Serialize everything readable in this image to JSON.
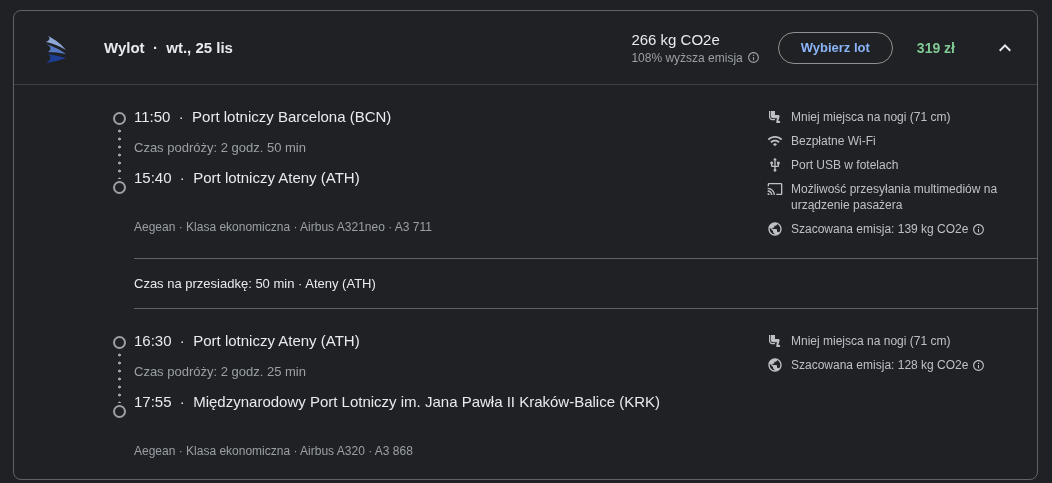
{
  "flight": {
    "title": "Wylot  ·  wt., 25 lis",
    "emissions": "266 kg CO2e",
    "emissions_note": "108% wyższa emisja",
    "select_button": "Wybierz lot",
    "price": "319 zł",
    "expanded": true
  },
  "legs": [
    {
      "kind": "flight",
      "departure": "11:50  ·  Port lotniczy Barcelona (BCN)",
      "duration": "Czas podróży: 2 godz. 50 min",
      "arrival": "15:40  ·  Port lotniczy Ateny (ATH)",
      "details": "Aegean · Klasa ekonomiczna · Airbus A321neo · A3 711",
      "amenities": [
        {
          "kind": "legroom",
          "text": "Mniej miejsca na nogi (71 cm)"
        },
        {
          "kind": "wifi",
          "text": "Bezpłatne Wi-Fi"
        },
        {
          "kind": "usb",
          "text": "Port USB w fotelach"
        },
        {
          "kind": "streaming",
          "text": "Możliwość przesyłania multimediów na urządzenie pasażera"
        },
        {
          "kind": "emissions",
          "text": "Szacowana emisja: 139 kg CO2e",
          "info": true
        }
      ]
    },
    {
      "kind": "layover",
      "text": "Czas na przesiadkę: 50 min · Ateny (ATH)"
    },
    {
      "kind": "flight",
      "departure": "16:30  ·  Port lotniczy Ateny (ATH)",
      "duration": "Czas podróży: 2 godz. 25 min",
      "arrival": "17:55  ·  Międzynarodowy Port Lotniczy im. Jana Pawła II Kraków-Balice (KRK)",
      "details": "Aegean · Klasa ekonomiczna · Airbus A320 · A3 868",
      "amenities": [
        {
          "kind": "legroom",
          "text": "Mniej miejsca na nogi (71 cm)"
        },
        {
          "kind": "emissions",
          "text": "Szacowana emisja: 128 kg CO2e",
          "info": true
        }
      ]
    }
  ]
}
